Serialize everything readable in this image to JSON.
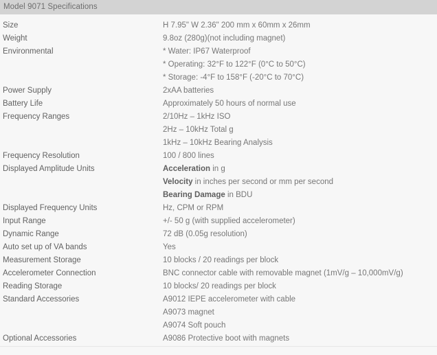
{
  "header": {
    "title": "Model 9071 Specifications",
    "background_color": "#d3d3d3",
    "text_color": "#6d6d6d"
  },
  "colors": {
    "page_background": "#f7f7f7",
    "label_text": "#626262",
    "value_text": "#777777",
    "emphasis_text": "#5e5e5e",
    "divider": "#e6e6e6"
  },
  "table": {
    "rows": [
      {
        "label": "Size",
        "value": "H 7.95\" W 2.36\" 200 mm x 60mm x 26mm"
      },
      {
        "label": "Weight",
        "value": "9.8oz (280g)(not including magnet)"
      },
      {
        "label": "Environmental",
        "value": "* Water: IP67 Waterproof"
      },
      {
        "label": "",
        "value": "* Operating: 32°F to 122°F (0°C to 50°C)"
      },
      {
        "label": "",
        "value": "* Storage: -4°F to 158°F (-20°C to 70°C)"
      },
      {
        "label": "Power Supply",
        "value": "2xAA batteries"
      },
      {
        "label": "Battery Life",
        "value": "Approximately 50 hours of normal use"
      },
      {
        "label": "Frequency Ranges",
        "value": "2/10Hz – 1kHz ISO"
      },
      {
        "label": "",
        "value": "2Hz – 10kHz Total g"
      },
      {
        "label": "",
        "value": "1kHz – 10kHz Bearing Analysis"
      },
      {
        "label": "Frequency Resolution",
        "value": "100 / 800 lines"
      },
      {
        "label": "Displayed Amplitude Units",
        "value_emphasis": "Acceleration",
        "value_rest": " in g"
      },
      {
        "label": "",
        "value_emphasis": "Velocity",
        "value_rest": " in inches per second or mm per second"
      },
      {
        "label": "",
        "value_emphasis": "Bearing Damage",
        "value_rest": " in BDU"
      },
      {
        "label": "Displayed Frequency Units",
        "value": "Hz, CPM or RPM"
      },
      {
        "label": "Input Range",
        "value": "+/- 50 g (with supplied accelerometer)"
      },
      {
        "label": "Dynamic Range",
        "value": "72 dB (0.05g resolution)"
      },
      {
        "label": "Auto set up of VA bands",
        "value": "Yes"
      },
      {
        "label": "Measurement Storage",
        "value": "10 blocks / 20 readings per block"
      },
      {
        "label": "Accelerometer Connection",
        "value": "BNC connector cable with removable magnet (1mV/g – 10,000mV/g)"
      },
      {
        "label": "Reading Storage",
        "value": "10 blocks/ 20 readings per block"
      },
      {
        "label": "Standard Accessories",
        "value": "A9012 IEPE accelerometer with cable"
      },
      {
        "label": "",
        "value": "A9073 magnet"
      },
      {
        "label": "",
        "value": "A9074 Soft pouch"
      },
      {
        "label": "Optional Accessories",
        "value": "A9086 Protective boot with magnets"
      }
    ]
  }
}
